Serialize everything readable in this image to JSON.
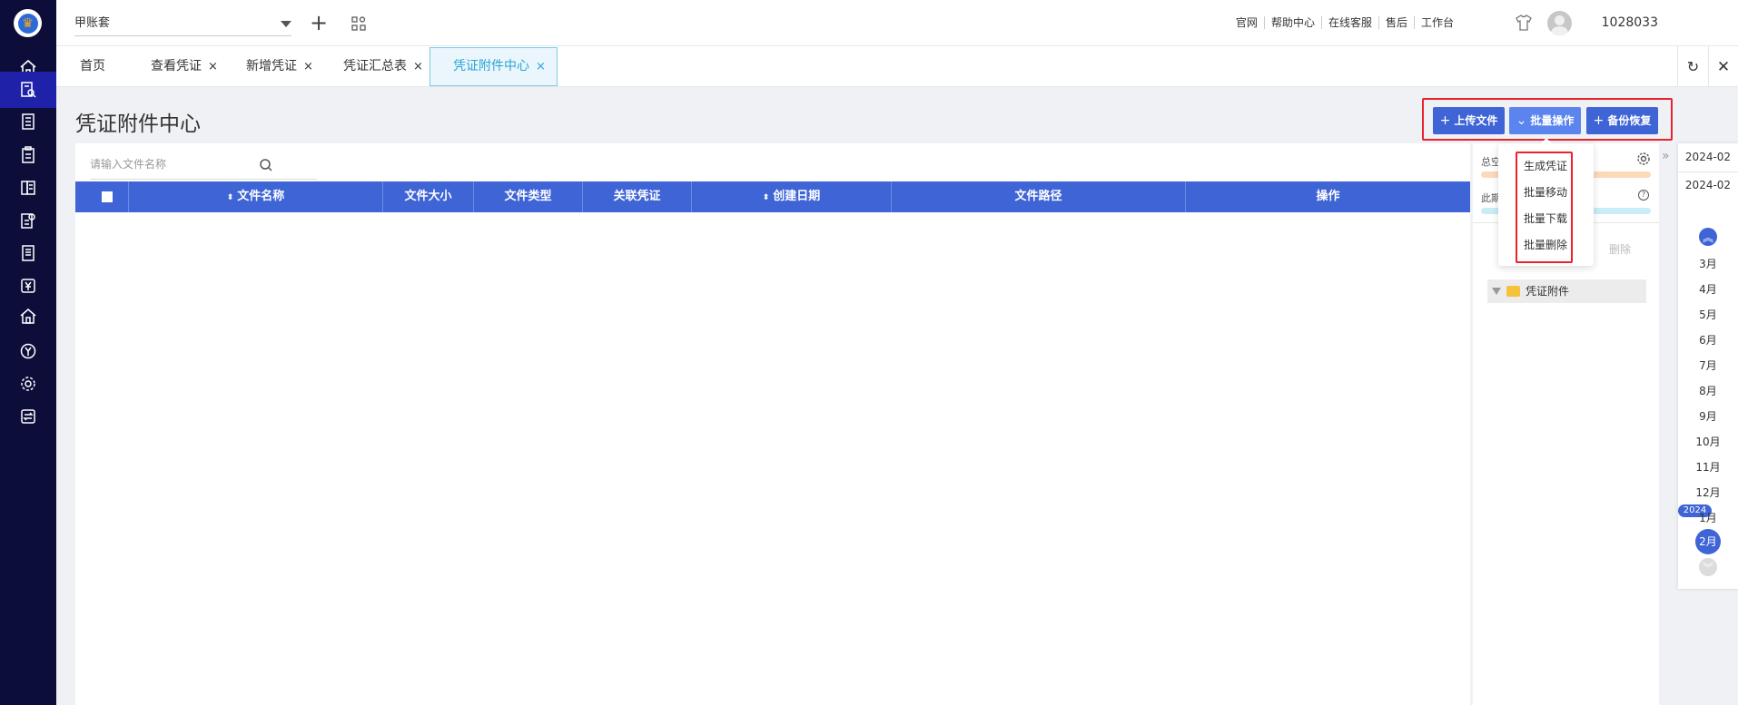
{
  "colors": {
    "nav_bg": "#0d0d3a",
    "nav_active": "#1f22a8",
    "primary": "#3e64d6",
    "highlight": "#e8232a",
    "tab_active_text": "#2aa4d8"
  },
  "nav": {
    "icons": [
      "home-icon",
      "voucher-search-icon",
      "ledger-icon",
      "clipboard-icon",
      "book-icon",
      "report-settings-icon",
      "document-icon",
      "yen-icon",
      "building-icon",
      "currency-icon",
      "gear-icon",
      "transfer-icon"
    ],
    "active_index": 1
  },
  "topbar": {
    "account": "甲账套",
    "links": [
      "官网",
      "帮助中心",
      "在线客服",
      "售后",
      "工作台"
    ],
    "user_id": "1028033"
  },
  "tabs": [
    {
      "label": "首页",
      "closable": false
    },
    {
      "label": "查看凭证",
      "closable": true
    },
    {
      "label": "新增凭证",
      "closable": true
    },
    {
      "label": "凭证汇总表",
      "closable": true
    },
    {
      "label": "凭证附件中心",
      "closable": true,
      "active": true
    }
  ],
  "tab_close_glyph": "×",
  "page": {
    "title": "凭证附件中心",
    "buttons": {
      "upload": "上传文件",
      "batch": "批量操作",
      "backup": "备份恢复"
    },
    "search_placeholder": "请输入文件名称"
  },
  "table": {
    "columns": [
      "",
      "文件名称",
      "文件大小",
      "文件类型",
      "关联凭证",
      "创建日期",
      "文件路径",
      "操作"
    ]
  },
  "batch_menu": [
    "生成凭证",
    "批量移动",
    "批量下载",
    "批量删除"
  ],
  "right_panel": {
    "total_label": "总空",
    "period_label": "此期",
    "delete_label": "删除",
    "folder": "凭证附件"
  },
  "date_panel": {
    "dates": [
      "2024-02",
      "2024-02"
    ],
    "months": [
      "3月",
      "4月",
      "5月",
      "6月",
      "7月",
      "8月",
      "9月",
      "10月",
      "11月",
      "12月",
      "1月"
    ],
    "year": "2024",
    "current_month": "2月"
  }
}
